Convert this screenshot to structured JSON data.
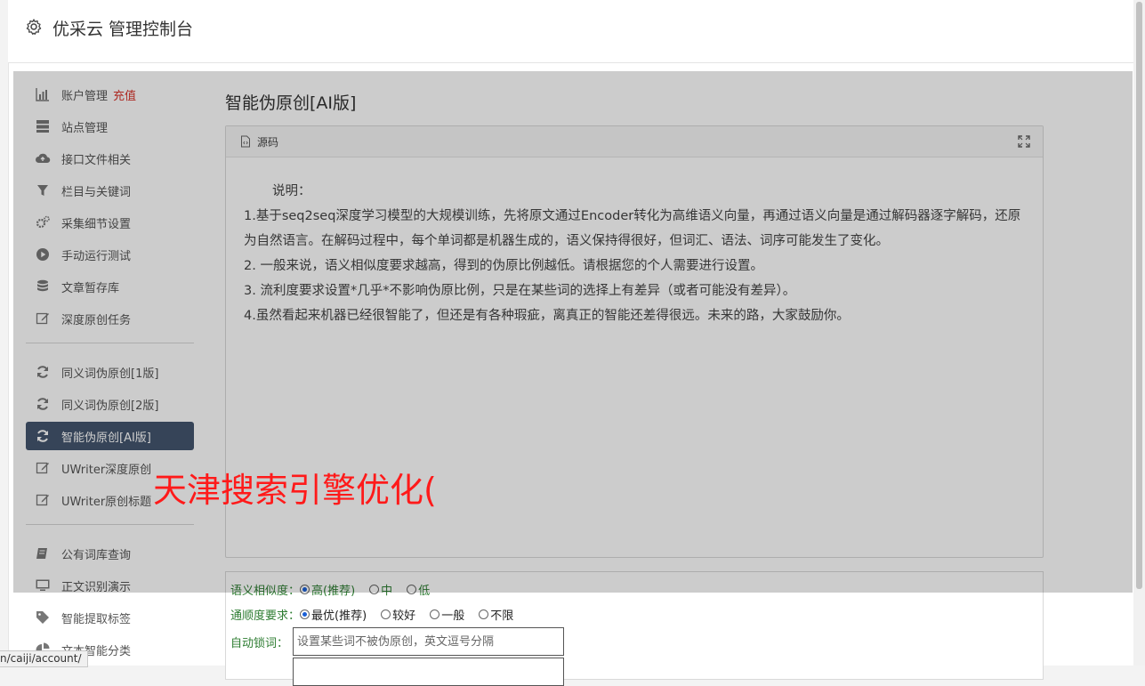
{
  "header": {
    "title": "优采云 管理控制台"
  },
  "sidebar": {
    "group1": [
      {
        "label": "账户管理",
        "extra": "充值",
        "icon": "bar-chart-icon"
      },
      {
        "label": "站点管理",
        "icon": "server-icon"
      },
      {
        "label": "接口文件相关",
        "icon": "cloud-upload-icon"
      },
      {
        "label": "栏目与关键词",
        "icon": "filter-icon"
      },
      {
        "label": "采集细节设置",
        "icon": "gears-icon"
      },
      {
        "label": "手动运行测试",
        "icon": "play-circle-icon"
      },
      {
        "label": "文章暂存库",
        "icon": "database-icon"
      },
      {
        "label": "深度原创任务",
        "icon": "edit-icon"
      }
    ],
    "group2": [
      {
        "label": "同义词伪原创[1版]",
        "icon": "refresh-icon"
      },
      {
        "label": "同义词伪原创[2版]",
        "icon": "refresh-icon"
      },
      {
        "label": "智能伪原创[AI版]",
        "icon": "refresh-icon",
        "active": true
      },
      {
        "label": "UWriter深度原创",
        "icon": "edit-icon"
      },
      {
        "label": "UWriter原创标题",
        "icon": "edit-icon"
      }
    ],
    "group3": [
      {
        "label": "公有词库查询",
        "icon": "book-icon"
      },
      {
        "label": "正文识别演示",
        "icon": "monitor-icon"
      },
      {
        "label": "智能提取标签",
        "icon": "tag-icon"
      },
      {
        "label": "文本智能分类",
        "icon": "pie-chart-icon"
      }
    ]
  },
  "main": {
    "title": "智能伪原创[AI版]",
    "panel": {
      "head_label": "源码",
      "lines": [
        "说明：",
        "1.基于seq2seq深度学习模型的大规模训练，先将原文通过Encoder转化为高维语义向量，再通过语义向量是通过解码器逐字解码，还原为自然语言。在解码过程中，每个单词都是机器生成的，语义保持得很好，但词汇、语法、词序可能发生了变化。",
        "2. 一般来说，语义相似度要求越高，得到的伪原比例越低。请根据您的个人需要进行设置。",
        "3. 流利度要求设置*几乎*不影响伪原比例，只是在某些词的选择上有差异（或者可能没有差异）。",
        "4.虽然看起来机器已经很智能了，但还是有各种瑕疵，离真正的智能还差得很远。未来的路，大家鼓励你。"
      ]
    },
    "form": {
      "similarity": {
        "label": "语义相似度：",
        "options": [
          "高(推荐)",
          "中",
          "低"
        ],
        "selected": 0
      },
      "fluency": {
        "label": "通顺度要求：",
        "options": [
          "最优(推荐)",
          "较好",
          "一般",
          "不限"
        ],
        "selected": 0
      },
      "lock": {
        "label": "自动锁词：",
        "placeholder": "设置某些词不被伪原创，英文逗号分隔"
      }
    }
  },
  "watermark": "天津搜索引擎优化(",
  "statusbar": {
    "url": "n/caiji/account/"
  },
  "colors": {
    "active_bg": "#44566e",
    "accent_red": "#d9342b",
    "form_green": "#2e7d32"
  }
}
